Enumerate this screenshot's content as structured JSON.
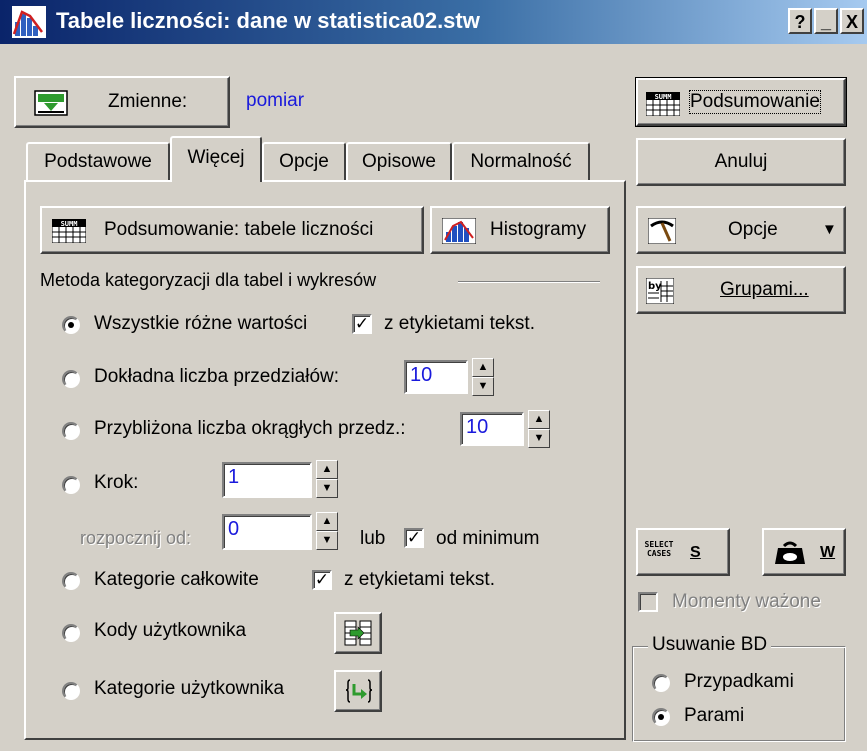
{
  "window": {
    "title": "Tabele liczności: dane w statistica02.stw",
    "help_btn": "?",
    "min_btn": "_",
    "close_btn": "X"
  },
  "variables": {
    "button_label": "Zmienne:",
    "value": "pomiar"
  },
  "tabs": [
    {
      "label": "Podstawowe"
    },
    {
      "label": "Więcej"
    },
    {
      "label": "Opcje"
    },
    {
      "label": "Opisowe"
    },
    {
      "label": "Normalność"
    }
  ],
  "panel": {
    "summary_tables_label": "Podsumowanie: tabele liczności",
    "histograms_label": "Histogramy",
    "group_title": "Metoda kategoryzacji dla tabel i wykresów",
    "opt_all_values": "Wszystkie różne wartości",
    "chk_text_labels_1": "z etykietami tekst.",
    "opt_exact_intervals": "Dokładna liczba przedziałów:",
    "exact_intervals_value": "10",
    "opt_approx_intervals": "Przybliżona liczba okrągłych przedz.:",
    "approx_intervals_value": "10",
    "opt_step": "Krok:",
    "step_value": "1",
    "start_from_label": "rozpocznij od:",
    "start_from_value": "0",
    "or_label": "lub",
    "chk_from_min": "od minimum",
    "opt_integer_categories": "Kategorie całkowite",
    "chk_text_labels_2": "z etykietami tekst.",
    "opt_user_codes": "Kody użytkownika",
    "opt_user_categories": "Kategorie użytkownika"
  },
  "side": {
    "summary_label": "Podsumowanie",
    "cancel_label": "Anuluj",
    "options_label": "Opcje",
    "groups_label": "Grupami...",
    "select_cases_icon_text": "SELECT CASES",
    "select_cases_key": "S",
    "weights_key": "W",
    "weighted_moments": "Momenty ważone",
    "md_group_title": "Usuwanie BD",
    "md_casewise": "Przypadkami",
    "md_pairwise": "Parami"
  },
  "icons": {
    "app": "histogram-app-icon",
    "summary": "summ-table-icon",
    "histogram": "histogram-icon",
    "options": "pickaxe-icon",
    "groups": "by-group-icon",
    "weights": "weight-icon"
  }
}
